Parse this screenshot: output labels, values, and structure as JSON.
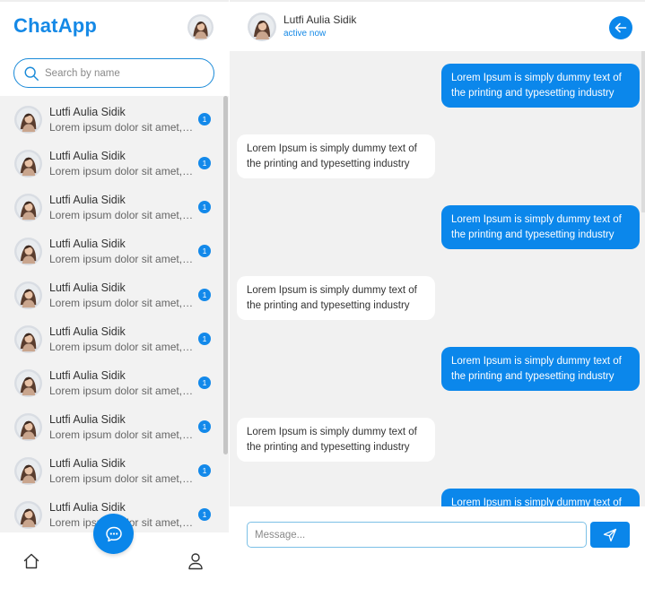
{
  "sidebar": {
    "brand": "ChatApp",
    "search": {
      "placeholder": "Search by name",
      "value": ""
    },
    "contacts": [
      {
        "name": "Lutfi Aulia Sidik",
        "preview": "Lorem ipsum dolor sit amet, consectetur",
        "unread": "1"
      },
      {
        "name": "Lutfi Aulia Sidik",
        "preview": "Lorem ipsum dolor sit amet, consectetur",
        "unread": "1"
      },
      {
        "name": "Lutfi Aulia Sidik",
        "preview": "Lorem ipsum dolor sit amet, consectetur",
        "unread": "1"
      },
      {
        "name": "Lutfi Aulia Sidik",
        "preview": "Lorem ipsum dolor sit amet, consectetur",
        "unread": "1"
      },
      {
        "name": "Lutfi Aulia Sidik",
        "preview": "Lorem ipsum dolor sit amet, consectetur",
        "unread": "1"
      },
      {
        "name": "Lutfi Aulia Sidik",
        "preview": "Lorem ipsum dolor sit amet, consectetur",
        "unread": "1"
      },
      {
        "name": "Lutfi Aulia Sidik",
        "preview": "Lorem ipsum dolor sit amet, consectetur",
        "unread": "1"
      },
      {
        "name": "Lutfi Aulia Sidik",
        "preview": "Lorem ipsum dolor sit amet, consectetur",
        "unread": "1"
      },
      {
        "name": "Lutfi Aulia Sidik",
        "preview": "Lorem ipsum dolor sit amet, consectetur",
        "unread": "1"
      },
      {
        "name": "Lutfi Aulia Sidik",
        "preview": "Lorem ipsum dolor sit amet, consectetur",
        "unread": "1"
      }
    ],
    "nav_icons": [
      "home-icon",
      "chat-bubble-icon",
      "user-icon"
    ]
  },
  "chat": {
    "peer_name": "Lutfi Aulia Sidik",
    "peer_status": "active now",
    "messages": [
      {
        "direction": "out",
        "text": "Lorem Ipsum is simply dummy text of the printing and typesetting industry"
      },
      {
        "direction": "in",
        "text": "Lorem Ipsum is simply dummy text of the printing and typesetting industry"
      },
      {
        "direction": "out",
        "text": "Lorem Ipsum is simply dummy text of the printing and typesetting industry"
      },
      {
        "direction": "in",
        "text": "Lorem Ipsum is simply dummy text of the printing and typesetting industry"
      },
      {
        "direction": "out",
        "text": "Lorem Ipsum is simply dummy text of the printing and typesetting industry"
      },
      {
        "direction": "in",
        "text": "Lorem Ipsum is simply dummy text of the printing and typesetting industry"
      },
      {
        "direction": "out",
        "text": "Lorem Ipsum is simply dummy text of the printing and typesetting industry"
      }
    ],
    "composer": {
      "placeholder": "Message...",
      "value": ""
    }
  },
  "colors": {
    "accent": "#0a86ea",
    "brand": "#1589e6",
    "list_bg": "#f2f2f2",
    "chat_bg": "#f1f1f1"
  }
}
